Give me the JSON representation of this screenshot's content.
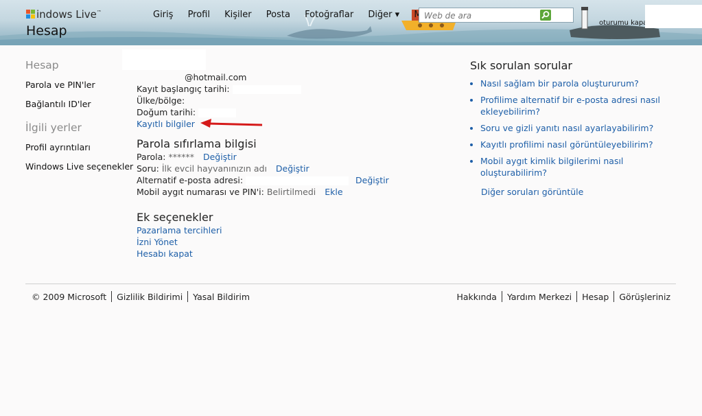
{
  "header": {
    "brand": "indows Live",
    "brand_tm": "™",
    "section_title": "Hesap",
    "nav": [
      "Giriş",
      "Profil",
      "Kişiler",
      "Posta",
      "Fotoğraflar",
      "Diğer ▾",
      "MSN"
    ],
    "search_placeholder": "Web de ara",
    "signout": "oturumu kapat"
  },
  "sidebar": {
    "heading1": "Hesap",
    "items1": [
      "Parola ve PIN'ler",
      "Bağlantılı ID'ler"
    ],
    "heading2": "İlgili yerler",
    "items2": [
      "Profil ayrıntıları",
      "Windows Live seçenekler"
    ]
  },
  "account": {
    "email_suffix": "@hotmail.com",
    "reg_date_label": "Kayıt başlangıç tarihi:",
    "country_label": "Ülke/bölge:",
    "birth_label": "Doğum tarihi:",
    "registered_info_link": "Kayıtlı bilgiler"
  },
  "password_reset": {
    "title": "Parola sıfırlama bilgisi",
    "password_label": "Parola:",
    "password_value": "******",
    "password_change": "Değiştir",
    "question_label": "Soru:",
    "question_value": "İlk evcil hayvanınızın adı",
    "question_change": "Değiştir",
    "alt_email_label": "Alternatif e-posta adresi:",
    "alt_email_change": "Değiştir",
    "mobile_label": "Mobil aygıt numarası ve PIN'i:",
    "mobile_value": "Belirtilmedi",
    "mobile_add": "Ekle"
  },
  "extra": {
    "title": "Ek seçenekler",
    "links": [
      "Pazarlama tercihleri",
      "İzni Yönet",
      "Hesabı kapat"
    ]
  },
  "faq": {
    "title": "Sık sorulan sorular",
    "items": [
      "Nasıl sağlam bir parola oluştururum?",
      "Profilime alternatif bir e-posta adresi nasıl ekleyebilirim?",
      "Soru ve gizli yanıtı nasıl ayarlayabilirim?",
      "Kayıtlı profilimi nasıl görüntüleyebilirim?",
      "Mobil aygıt kimlik bilgilerimi nasıl oluşturabilirim?"
    ],
    "more": "Diğer soruları görüntüle"
  },
  "footer": {
    "left": [
      "© 2009 Microsoft",
      "Gizlilik Bildirimi",
      "Yasal Bildirim"
    ],
    "right": [
      "Hakkında",
      "Yardım Merkezi",
      "Hesap",
      "Görüşleriniz"
    ]
  },
  "colors": {
    "link": "#1e5fa8",
    "arrow": "#d51a1a",
    "header_sky": "#c4d7e0"
  }
}
